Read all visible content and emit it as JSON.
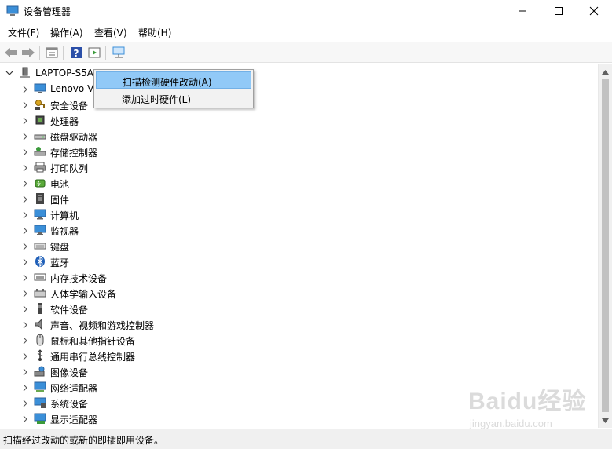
{
  "window": {
    "title": "设备管理器"
  },
  "menubar": {
    "items": [
      "文件(F)",
      "操作(A)",
      "查看(V)",
      "帮助(H)"
    ]
  },
  "tree": {
    "root": "LAPTOP-S5AU",
    "nodes": [
      {
        "label": "Lenovo Vi",
        "icon": "computer-icon"
      },
      {
        "label": "安全设备",
        "icon": "key-icon"
      },
      {
        "label": "处理器",
        "icon": "chip-icon"
      },
      {
        "label": "磁盘驱动器",
        "icon": "disk-drive-icon"
      },
      {
        "label": "存储控制器",
        "icon": "storage-controller-icon"
      },
      {
        "label": "打印队列",
        "icon": "printer-icon"
      },
      {
        "label": "电池",
        "icon": "battery-icon"
      },
      {
        "label": "固件",
        "icon": "firmware-icon"
      },
      {
        "label": "计算机",
        "icon": "monitor-icon"
      },
      {
        "label": "监视器",
        "icon": "monitor-icon"
      },
      {
        "label": "键盘",
        "icon": "keyboard-icon"
      },
      {
        "label": "蓝牙",
        "icon": "bluetooth-icon"
      },
      {
        "label": "内存技术设备",
        "icon": "memory-icon"
      },
      {
        "label": "人体学输入设备",
        "icon": "hid-icon"
      },
      {
        "label": "软件设备",
        "icon": "software-device-icon"
      },
      {
        "label": "声音、视频和游戏控制器",
        "icon": "speaker-icon"
      },
      {
        "label": "鼠标和其他指针设备",
        "icon": "mouse-icon"
      },
      {
        "label": "通用串行总线控制器",
        "icon": "usb-icon"
      },
      {
        "label": "图像设备",
        "icon": "camera-icon"
      },
      {
        "label": "网络适配器",
        "icon": "network-adapter-icon"
      },
      {
        "label": "系统设备",
        "icon": "system-device-icon"
      },
      {
        "label": "显示适配器",
        "icon": "display-adapter-icon"
      }
    ]
  },
  "context_menu": {
    "items": [
      "扫描检测硬件改动(A)",
      "添加过时硬件(L)"
    ]
  },
  "statusbar": {
    "text": "扫描经过改动的或新的即插即用设备。"
  },
  "watermark": {
    "main": "Baidu经验",
    "sub": "jingyan.baidu.com"
  },
  "colors": {
    "highlight": "#91c9f7",
    "icon_blue": "#3b8fd8"
  }
}
